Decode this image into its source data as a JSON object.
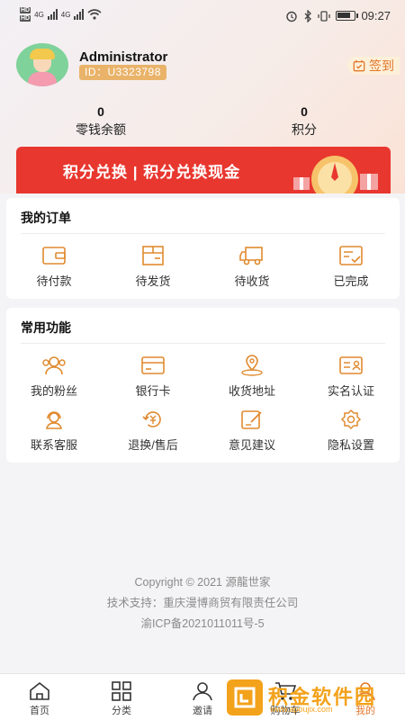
{
  "status_bar": {
    "hd1": "HD",
    "hd2": "HD",
    "net1": "4G",
    "net2": "4G",
    "time": "09:27"
  },
  "profile": {
    "name": "Administrator",
    "id": "ID：U3323798",
    "signin_label": "签到"
  },
  "stats": {
    "balance_value": "0",
    "balance_label": "零钱余额",
    "points_value": "0",
    "points_label": "积分"
  },
  "banner": {
    "text": "积分兑换 | 积分兑换现金"
  },
  "orders": {
    "title": "我的订单",
    "items": [
      {
        "label": "待付款",
        "icon": "wallet-icon"
      },
      {
        "label": "待发货",
        "icon": "box-icon"
      },
      {
        "label": "待收货",
        "icon": "truck-icon"
      },
      {
        "label": "已完成",
        "icon": "completed-icon"
      }
    ]
  },
  "functions": {
    "title": "常用功能",
    "items": [
      {
        "label": "我的粉丝",
        "icon": "fans-icon"
      },
      {
        "label": "银行卡",
        "icon": "bank-card-icon"
      },
      {
        "label": "收货地址",
        "icon": "location-icon"
      },
      {
        "label": "实名认证",
        "icon": "id-card-icon"
      },
      {
        "label": "联系客服",
        "icon": "customer-service-icon"
      },
      {
        "label": "退换/售后",
        "icon": "refund-icon"
      },
      {
        "label": "意见建议",
        "icon": "feedback-icon"
      },
      {
        "label": "隐私设置",
        "icon": "settings-icon"
      }
    ]
  },
  "footer": {
    "copyright": "Copyright © 2021 源龍世家",
    "support": "技术支持：重庆漫博商贸有限责任公司",
    "icp": "渝ICP备2021011011号-5"
  },
  "tabbar": {
    "items": [
      {
        "label": "首页",
        "icon": "home-icon"
      },
      {
        "label": "分类",
        "icon": "category-icon"
      },
      {
        "label": "邀请",
        "icon": "invite-icon"
      },
      {
        "label": "购物车",
        "icon": "cart-icon"
      },
      {
        "label": "我的",
        "icon": "user-icon"
      }
    ]
  },
  "watermark": {
    "text": "积金软件园",
    "url": "www.apoujix.com"
  },
  "colors": {
    "accent": "#e2772b",
    "banner_red": "#e8372f",
    "id_badge": "#e9b36a",
    "icon_orange": "#e08a2e"
  }
}
